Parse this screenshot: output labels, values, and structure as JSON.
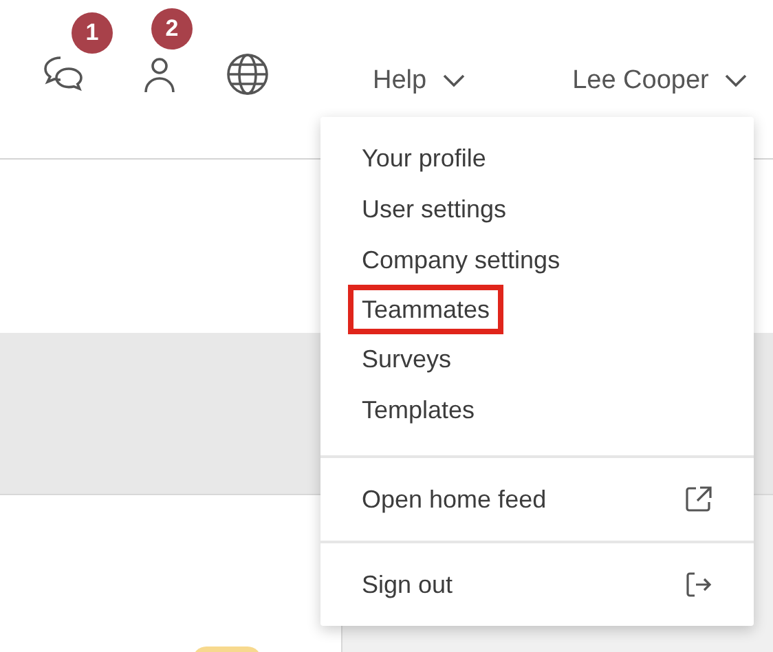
{
  "header": {
    "badges": [
      "1",
      "2"
    ],
    "help": "Help",
    "user": "Lee Cooper"
  },
  "menu": {
    "items": [
      {
        "label": "Your profile",
        "highlighted": false
      },
      {
        "label": "User settings",
        "highlighted": false
      },
      {
        "label": "Company settings",
        "highlighted": false
      },
      {
        "label": "Teammates",
        "highlighted": true
      },
      {
        "label": "Surveys",
        "highlighted": false
      },
      {
        "label": "Templates",
        "highlighted": false
      }
    ],
    "links": [
      {
        "label": "Open home feed",
        "kind": "external"
      },
      {
        "label": "Sign out",
        "kind": "signout"
      }
    ]
  }
}
